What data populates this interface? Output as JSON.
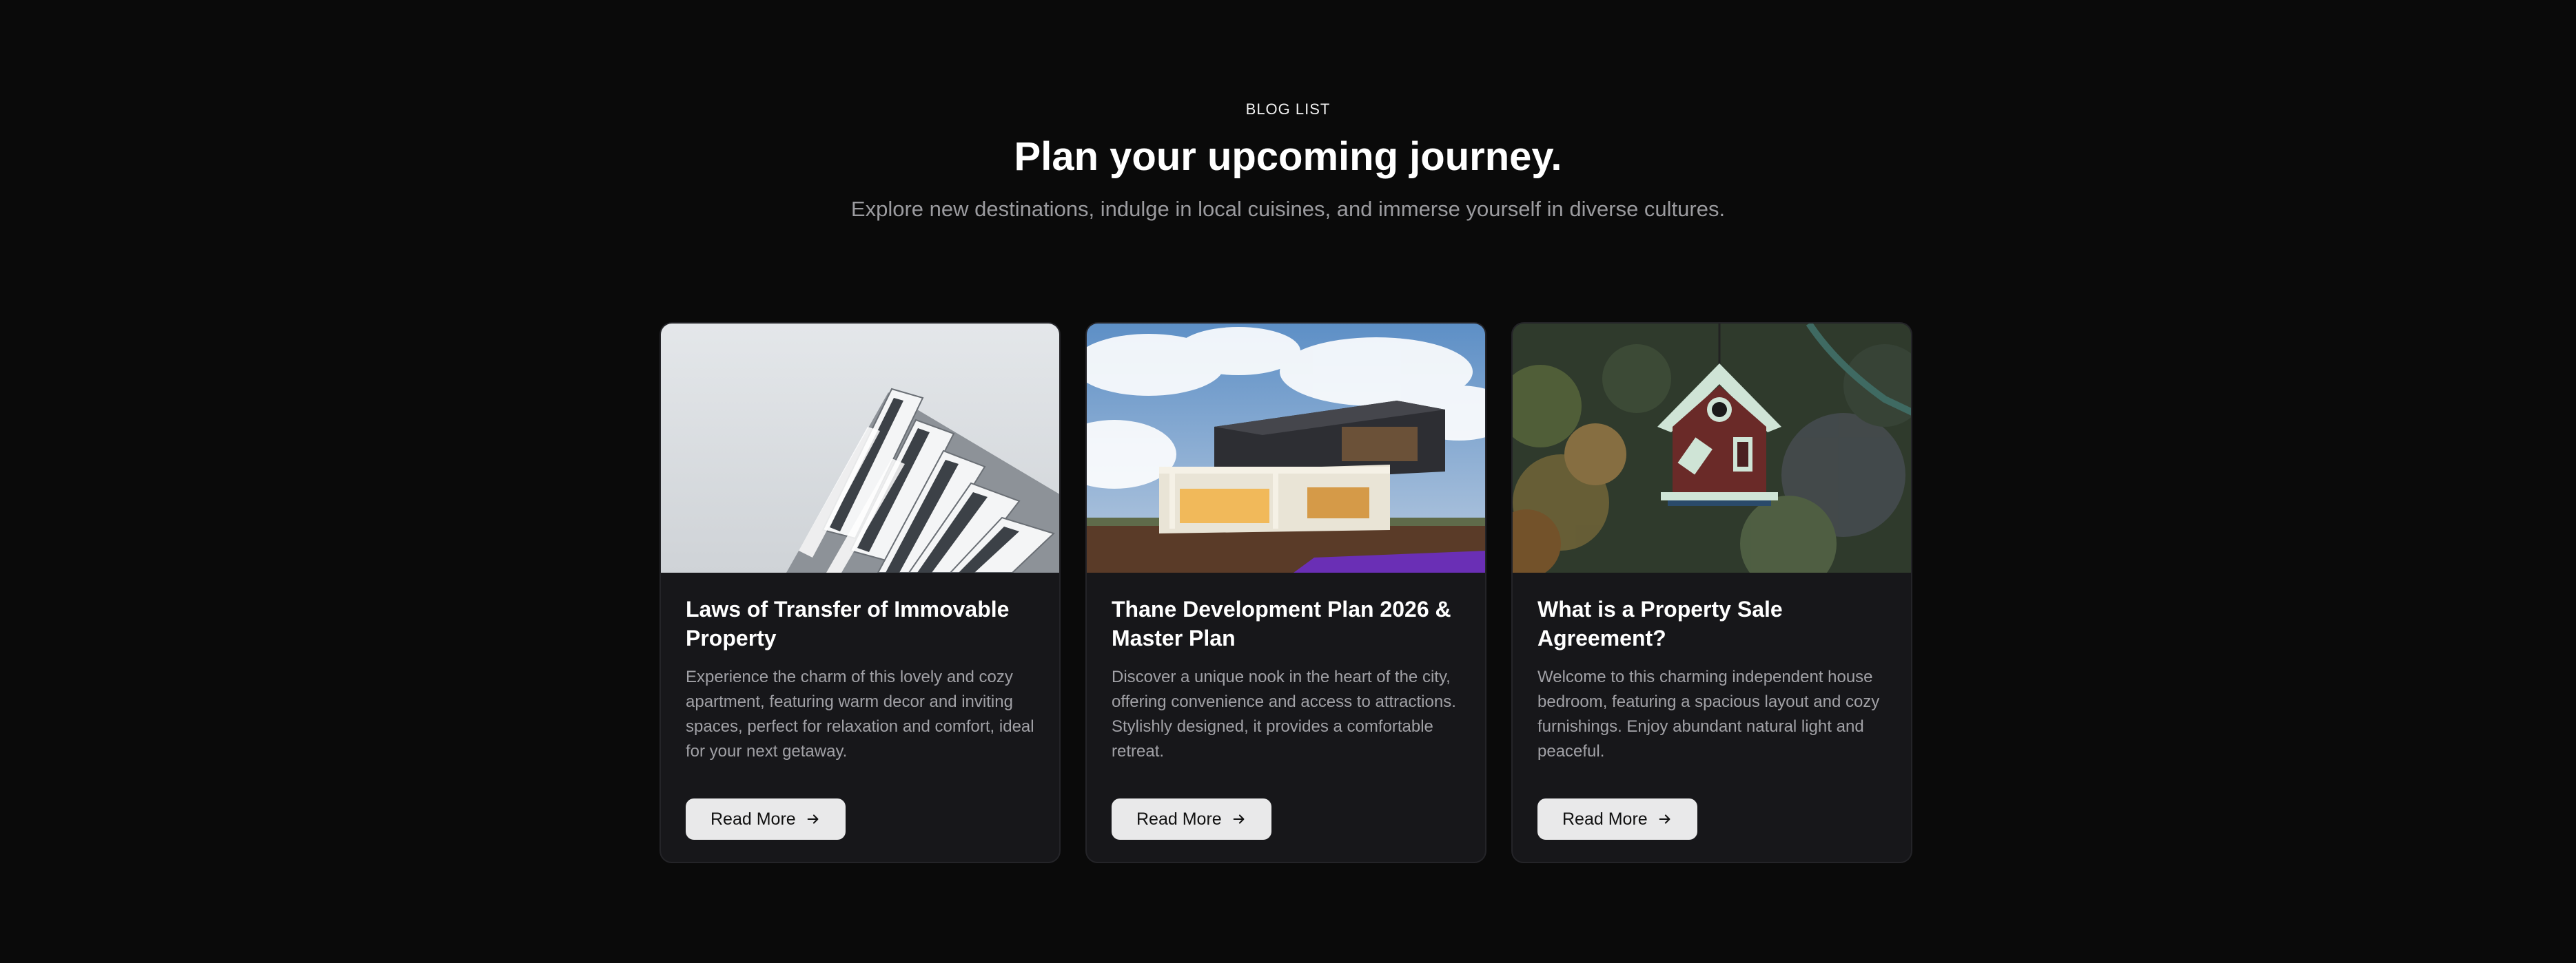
{
  "header": {
    "eyebrow": "BLOG LIST",
    "title": "Plan your upcoming journey.",
    "subtitle": "Explore new destinations, indulge in local cuisines, and immerse yourself in diverse cultures."
  },
  "cards": [
    {
      "image_icon": "modern-building-photo",
      "title": "Laws of Transfer of Immovable Property",
      "description": "Experience the charm of this lovely and cozy apartment, featuring warm decor and inviting spaces, perfect for relaxation and comfort, ideal for your next getaway.",
      "button_label": "Read More"
    },
    {
      "image_icon": "modern-house-photo",
      "title": "Thane Development Plan 2026 & Master Plan",
      "description": "Discover a unique nook in the heart of the city, offering convenience and access to attractions. Stylishly designed, it provides a comfortable retreat.",
      "button_label": "Read More"
    },
    {
      "image_icon": "birdhouse-photo",
      "title": "What is a Property Sale Agreement?",
      "description": "Welcome to this charming independent house bedroom, featuring a spacious layout and cozy furnishings. Enjoy abundant natural light and peaceful.",
      "button_label": "Read More"
    }
  ],
  "icons": {
    "button_arrow": "arrow-right-icon"
  },
  "colors": {
    "background": "#0a0a0a",
    "card_background": "#17171a",
    "button_background": "#e9e9ea"
  }
}
